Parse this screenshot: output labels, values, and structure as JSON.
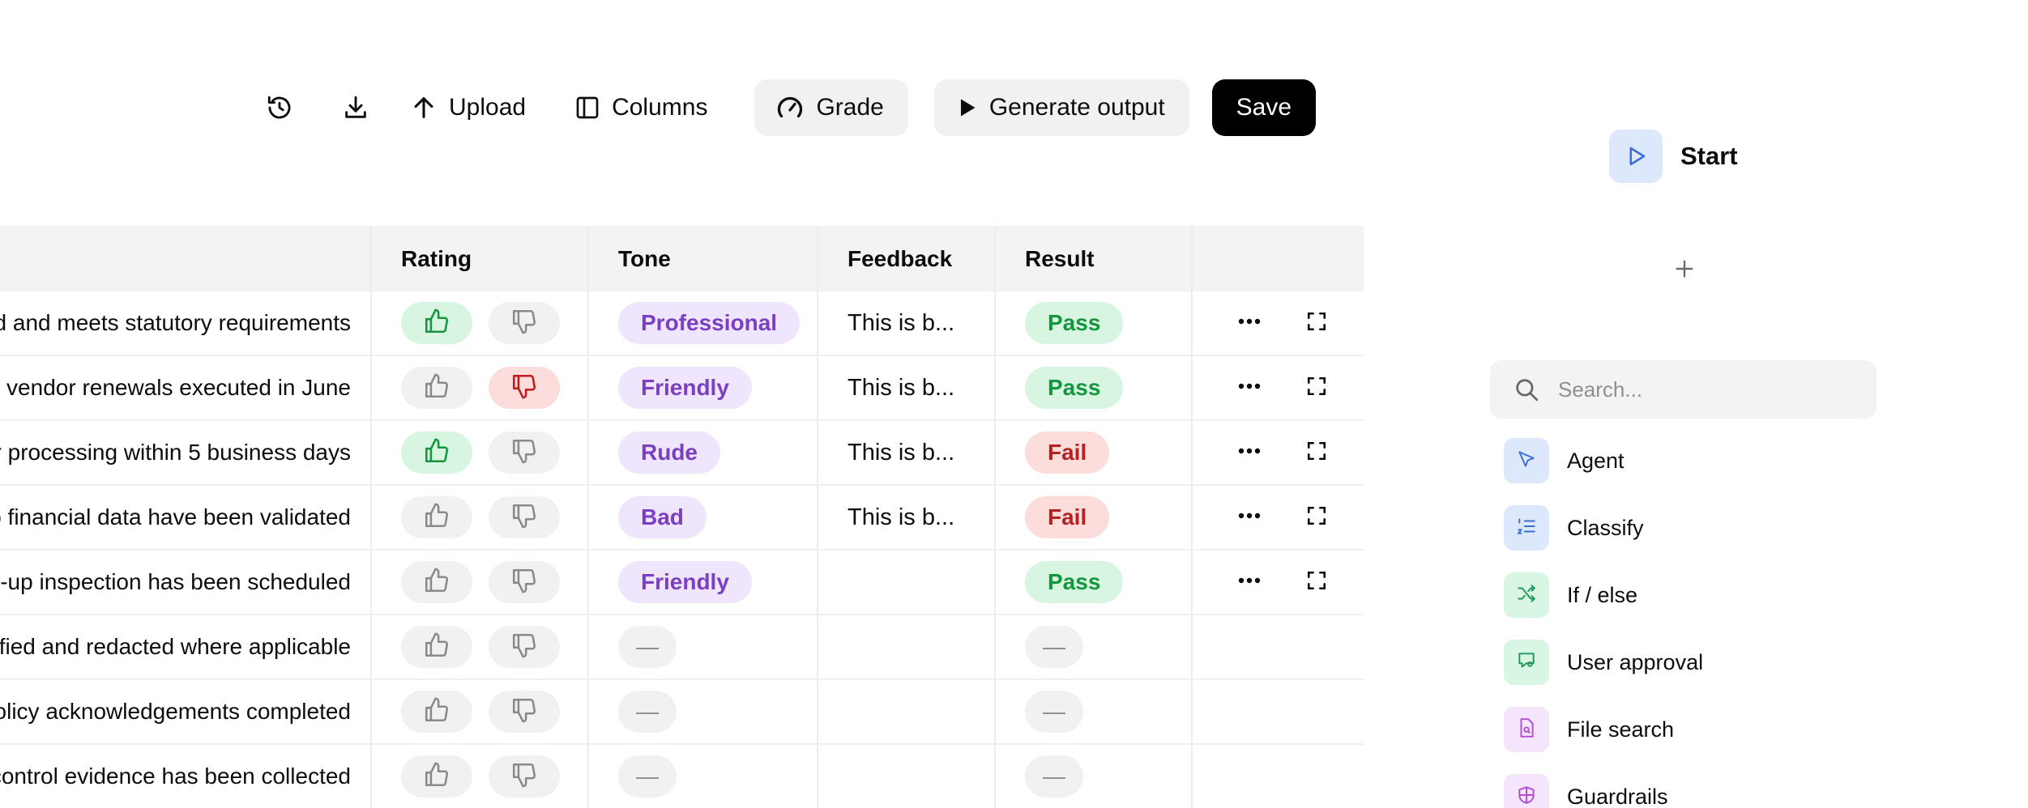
{
  "toolbar": {
    "history_icon": "history-icon",
    "download_icon": "download-icon",
    "upload_label": "Upload",
    "columns_label": "Columns",
    "grade_label": "Grade",
    "generate_label": "Generate output",
    "save_label": "Save"
  },
  "table": {
    "headers": {
      "rating": "Rating",
      "tone": "Tone",
      "feedback": "Feedback",
      "result": "Result"
    },
    "rows": [
      {
        "text": "d and meets statutory requirements",
        "rating": "up",
        "tone": "Professional",
        "feedback": "This is b...",
        "result": "Pass",
        "actions": true
      },
      {
        "text": "d vendor renewals executed in June",
        "rating": "down",
        "tone": "Friendly",
        "feedback": "This is b...",
        "result": "Pass",
        "actions": true
      },
      {
        "text": "r processing within 5 business days",
        "rating": "up",
        "tone": "Rude",
        "feedback": "This is b...",
        "result": "Fail",
        "actions": true
      },
      {
        "text": "o financial data have been validated",
        "rating": "none",
        "tone": "Bad",
        "feedback": "This is b...",
        "result": "Fail",
        "actions": true
      },
      {
        "text": "y-up inspection has been scheduled",
        "rating": "none",
        "tone": "Friendly",
        "feedback": "",
        "result": "Pass",
        "actions": true
      },
      {
        "text": "tified and redacted where applicable",
        "rating": "none",
        "tone": "—",
        "feedback": "",
        "result": "—",
        "actions": false
      },
      {
        "text": "olicy acknowledgements completed",
        "rating": "none",
        "tone": "—",
        "feedback": "",
        "result": "—",
        "actions": false
      },
      {
        "text": "control evidence has been collected",
        "rating": "none",
        "tone": "—",
        "feedback": "",
        "result": "—",
        "actions": false
      }
    ]
  },
  "panel": {
    "start_label": "Start",
    "search_placeholder": "Search...",
    "nodes": [
      {
        "label": "Agent",
        "icon": "cursor-icon",
        "bg": "#dde8fd",
        "fg": "#3b6fd8"
      },
      {
        "label": "Classify",
        "icon": "list-icon",
        "bg": "#dde8fd",
        "fg": "#3b6fd8"
      },
      {
        "label": "If / else",
        "icon": "shuffle-icon",
        "bg": "#d9f5e4",
        "fg": "#1f9a5b"
      },
      {
        "label": "User approval",
        "icon": "approval-icon",
        "bg": "#d9f5e4",
        "fg": "#1f9a5b"
      },
      {
        "label": "File search",
        "icon": "file-search-icon",
        "bg": "#f5e6fd",
        "fg": "#b14bd8"
      },
      {
        "label": "Guardrails",
        "icon": "shield-icon",
        "bg": "#f5e6fd",
        "fg": "#b14bd8"
      }
    ]
  }
}
